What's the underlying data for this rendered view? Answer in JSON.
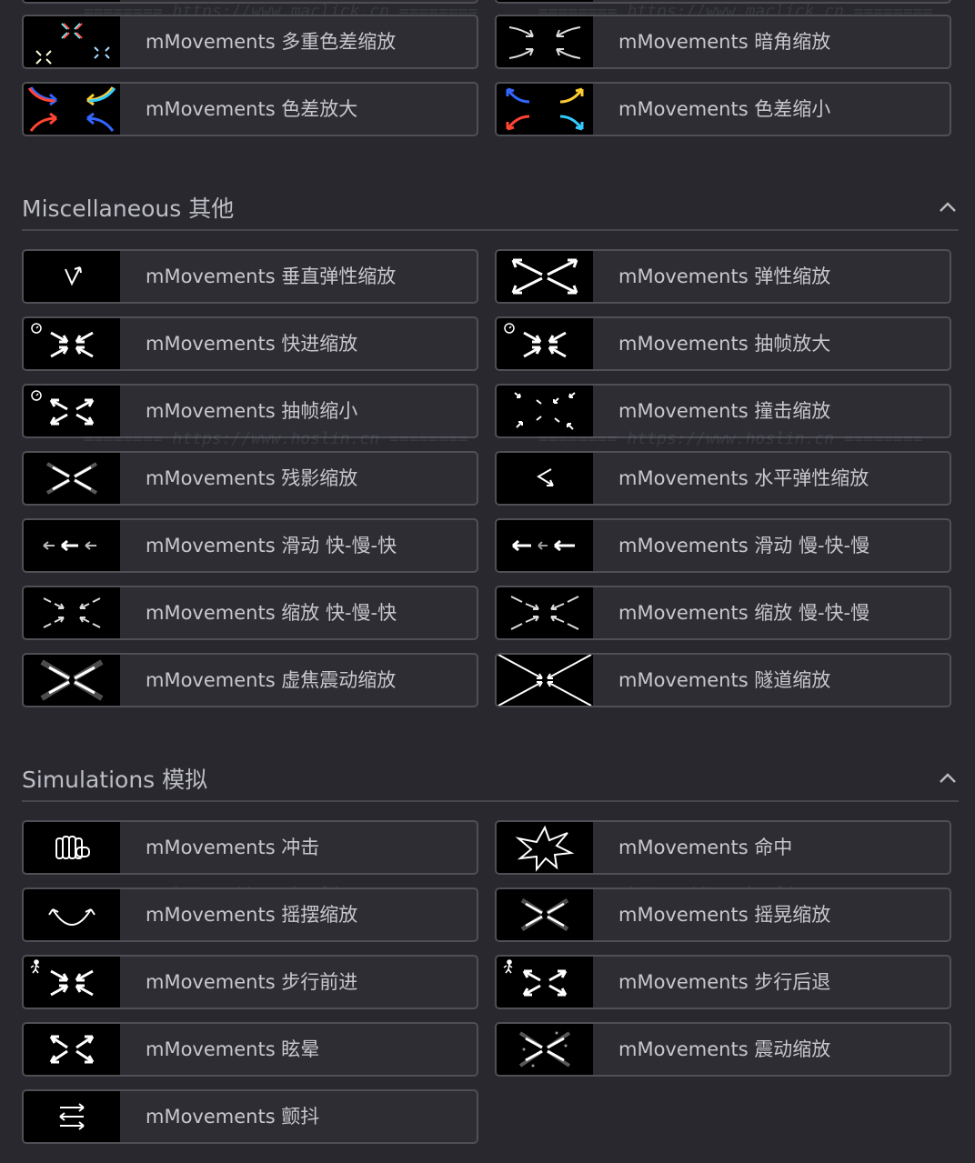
{
  "sections": [
    {
      "title": "Miscellaneous 其他",
      "collapse_icon": "chevron-up-icon"
    },
    {
      "title": "Simulations 模拟",
      "collapse_icon": "chevron-up-icon"
    }
  ],
  "items": {
    "multi_chroma_zoom": "mMovements 多重色差缩放",
    "vignette_zoom": "mMovements 暗角缩放",
    "chroma_zoom_in": "mMovements 色差放大",
    "chroma_zoom_out": "mMovements 色差缩小",
    "vertical_elastic_zoom": "mMovements 垂直弹性缩放",
    "elastic_zoom": "mMovements 弹性缩放",
    "fast_forward_zoom": "mMovements 快进缩放",
    "frame_drop_zoom_in": "mMovements 抽帧放大",
    "frame_drop_zoom_out": "mMovements 抽帧缩小",
    "impact_zoom": "mMovements 撞击缩放",
    "ghost_zoom": "mMovements 残影缩放",
    "horizontal_elastic_zoom": "mMovements 水平弹性缩放",
    "slide_fast_slow_fast": "mMovements 滑动 快-慢-快",
    "slide_slow_fast_slow": "mMovements 滑动 慢-快-慢",
    "zoom_fast_slow_fast": "mMovements 缩放 快-慢-快",
    "zoom_slow_fast_slow": "mMovements 缩放 慢-快-慢",
    "blur_shake_zoom": "mMovements 虚焦震动缩放",
    "tunnel_zoom": "mMovements 隧道缩放",
    "punch": "mMovements 冲击",
    "hit": "mMovements 命中",
    "swing_zoom": "mMovements 摇摆缩放",
    "sway_zoom": "mMovements 摇晃缩放",
    "walk_forward": "mMovements 步行前进",
    "walk_backward": "mMovements 步行后退",
    "dizzy": "mMovements 眩晕",
    "shake_zoom": "mMovements 震动缩放",
    "tremble": "mMovements 颤抖"
  },
  "watermarks": {
    "maclick": "======== https://www.maclick.cn ========",
    "hoslin": "======== https://www.hoslin.cn ========"
  }
}
